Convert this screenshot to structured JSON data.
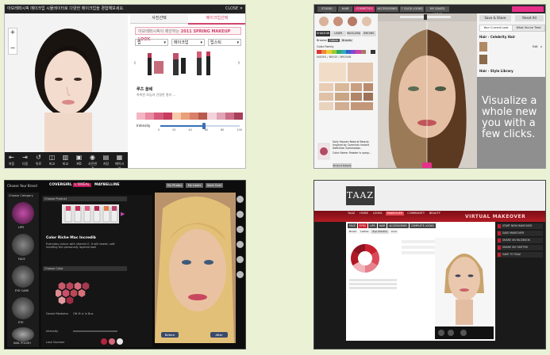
{
  "panel1": {
    "topbar_text": "아모레퍼시픽 메이크업 시뮬레이터로 다양한 메이크업을 경험해보세요.",
    "close_label": "CLOSE ✕",
    "zoom_in": "+",
    "zoom_out": "−",
    "toolbar": [
      "처음",
      "다음",
      "뒤로",
      "비교",
      "비교",
      "HD",
      "사진변경",
      "저장",
      "메이크업"
    ],
    "tab_left": "사진선택",
    "tab_right": "메이크업선택",
    "banner": "2011 SPRING MAKEUP LOOK",
    "banner_prefix": "아모레퍼시픽이 제안하는",
    "select_1": "립",
    "select_2": "메이크업",
    "select_3": "립스틱",
    "product_title": "루즈 올쉐",
    "product_desc": "촉촉한 보습과 선명한 컬러 ...",
    "intensity_label": "Intensity",
    "intensity_ticks": [
      "0",
      "20",
      "40",
      "60",
      "80",
      "100"
    ],
    "intensity_value": 0.55,
    "palette": [
      "#f4b6c3",
      "#e88aa2",
      "#d65a7c",
      "#c83c5e",
      "#f7c9a8",
      "#e8a07c",
      "#d9806a",
      "#b85a4e",
      "#f2d3d9",
      "#e0a4b4",
      "#cc6d88",
      "#a8405c"
    ]
  },
  "panel2": {
    "nav": [
      "STUDIO HOME",
      "HAIR",
      "COSMETICS",
      "ACCESSORIES",
      "7 CLICK LOOKS",
      "MY SAVED LOOKS"
    ],
    "save_share": "Save & Share",
    "reset": "Reset All",
    "tab_current": "Your Current Look",
    "tab_tried": "What You've Tried",
    "section_hair": "Hair - Celebrity Hair",
    "section_hair2": "Hair - Style Library",
    "edit_label": "Edit",
    "x_label": "x",
    "tagline": "Visualize a whole new you with a few clicks.",
    "category_tabs": [
      "SHADOW",
      "LINER",
      "MASCARA",
      "BROWS"
    ],
    "browse_label": "Browse",
    "brand_tabs": [
      "Colors",
      "Brands"
    ],
    "color_family_label": "Color Family",
    "selected_color": "NUDES / BEIGE / BROWN",
    "product_name": "Sally Hansen Natural Beauty Inspired by Carmindy Instant Definition Eyeshadow...",
    "product_color_label": "Color Name:",
    "price_label": "Powder is spray...",
    "apply_label": "Light - Dark",
    "more_options": "More Options",
    "product_details": "Product Details"
  },
  "panel3": {
    "brand_heading": "Choose Your Brand",
    "brands": [
      "COVERGIRL",
      "L'ORÉAL",
      "MAYBELLINE"
    ],
    "top_buttons": [
      "My Photos",
      "My Looks",
      "Start Over"
    ],
    "sidebar_title": "Choose Category",
    "categories": [
      "LIPS",
      "FACE",
      "EYE CARE",
      "EYE",
      "NAIL POLISH"
    ],
    "choose_product": "Choose Product",
    "product_name": "Color Riche Mac Incredib",
    "product_desc": "Everyday colour with vitamin E. It will shade, soft meeting the personally layered look",
    "choose_color": "Choose Color",
    "control_labels": [
      "Gerald Mediator",
      "Intensity",
      "Lash Number"
    ],
    "control_value": "ON M ≠ In Bus",
    "before_label": "Before",
    "after_label": "After",
    "hex_colors": [
      "#c8596b",
      "#b9455a",
      "#d76c7c",
      "#a33a4f",
      "#e08a8f",
      "#c9506c",
      "#b84a56",
      "#d8707a",
      "#e39aa0",
      "#9f2c44"
    ]
  },
  "panel4": {
    "logo": "TAAZ",
    "nav": [
      "TAAZ",
      "HOME",
      "LOOKS",
      "MAKEOVER",
      "COMMUNITY",
      "BEAUTY"
    ],
    "banner_text": "VIRTUAL MAKEOVER",
    "tabs": [
      "FACE",
      "EYES",
      "LIPS",
      "HAIR",
      "ACCESSORIES",
      "COMPLETE LOOKS"
    ],
    "sub_tabs": [
      "Brows",
      "Lashes",
      "Eye Shadow",
      "Liner"
    ],
    "actions": [
      "START NEW MAKEOVER",
      "SAVE MAKEOVER",
      "SHARE ON FACEBOOK",
      "SHARE ON TWITTER",
      "SAVE TO TAAZ"
    ],
    "color_ring": [
      "#c9202f",
      "#d94a58",
      "#e6828c",
      "#f0b4ba",
      "#b01624",
      "#8e1220"
    ]
  }
}
